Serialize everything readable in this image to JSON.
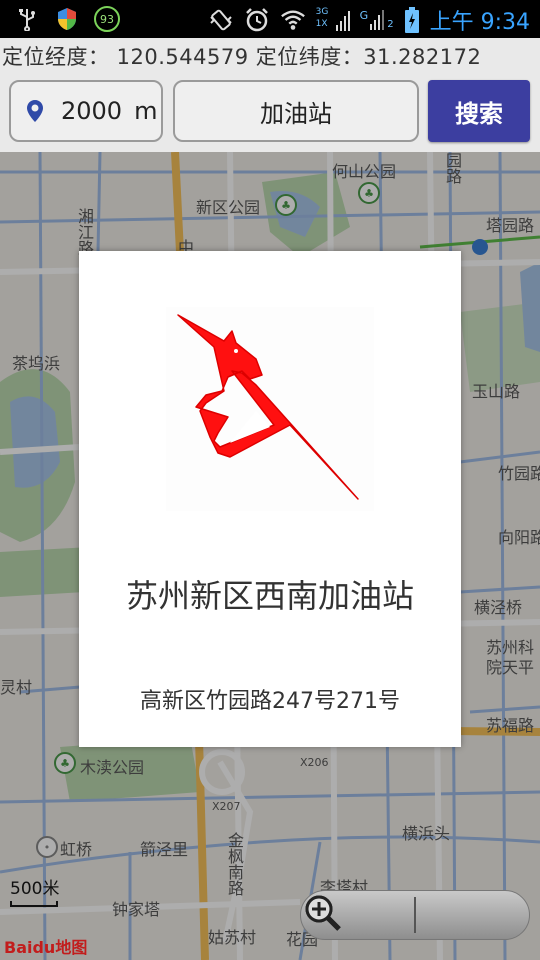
{
  "status_bar": {
    "battery_level": "93",
    "network_type": "3G",
    "signal_type": "1X",
    "sim_slot": "2",
    "time": "上午 9:34"
  },
  "location": {
    "text": "定位经度： 120.544579 定位纬度：31.282172"
  },
  "search": {
    "radius_value": "2000",
    "radius_unit": "m",
    "keyword": "加油站",
    "button_label": "搜索"
  },
  "map": {
    "labels": {
      "heshan_park": "何山公园",
      "xinqu_park": "新区公园",
      "tayuan_rd": "塔园路",
      "xiangjiang_rd": "湘江路",
      "yushan_rd": "玉山路",
      "chawubang": "茶坞浜",
      "zhuyuan_rd": "竹园路",
      "xiangyang_rd": "向阳路",
      "hengtang_bridge": "横泾桥",
      "suzhou_institute": "苏州科院天平",
      "lingcun": "灵村",
      "sufu_rd": "苏福路",
      "mudu_park": "木渎公园",
      "x206": "X206",
      "x207": "X207",
      "zhuwanli": "箭泾里",
      "hongqiao": "虹桥",
      "hengbin": "横浜头",
      "zhongjiata": "钟家塔",
      "lita_village": "李塔村",
      "gusu_village": "姑苏村",
      "huayuan": "花园",
      "jinxi_south_rd": "金枫南路",
      "yuan_rd": "园路",
      "zhong": "中"
    },
    "scale": "500米",
    "brand": "Baidu地图"
  },
  "dialog": {
    "name": "苏州新区西南加油站",
    "address": "高新区竹园路247号271号"
  },
  "colors": {
    "search_button": "#3c3ea0",
    "logo_red": "#ff1010",
    "clock_blue": "#39a4ff"
  }
}
